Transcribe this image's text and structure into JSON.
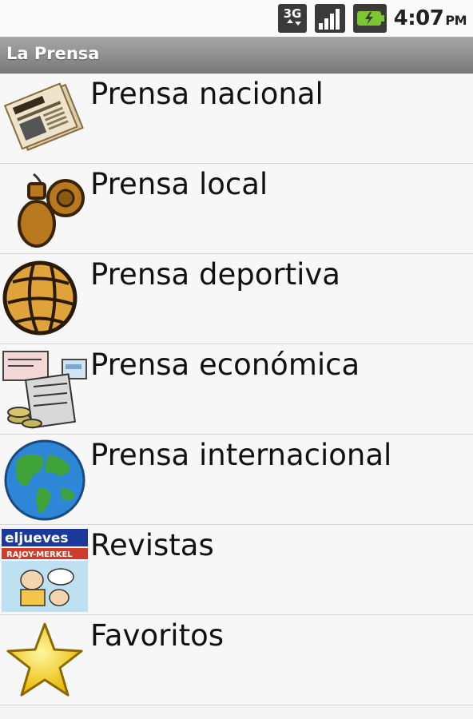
{
  "status_bar": {
    "network_icon": "3g-icon",
    "signal_icon": "signal-icon",
    "battery_icon": "battery-charging-icon",
    "time": "4:07",
    "ampm": "PM"
  },
  "app": {
    "title": "La Prensa"
  },
  "menu": [
    {
      "label": "Prensa nacional",
      "icon": "newspaper-icon"
    },
    {
      "label": "Prensa local",
      "icon": "castanets-icon"
    },
    {
      "label": "Prensa deportiva",
      "icon": "football-icon"
    },
    {
      "label": "Prensa económica",
      "icon": "finance-documents-icon"
    },
    {
      "label": "Prensa internacional",
      "icon": "globe-icon"
    },
    {
      "label": "Revistas",
      "icon": "magazine-cover-icon",
      "cover_text": {
        "masthead": "eljueves",
        "headline": "RAJOY-MERKEL"
      }
    },
    {
      "label": "Favoritos",
      "icon": "star-icon"
    }
  ]
}
